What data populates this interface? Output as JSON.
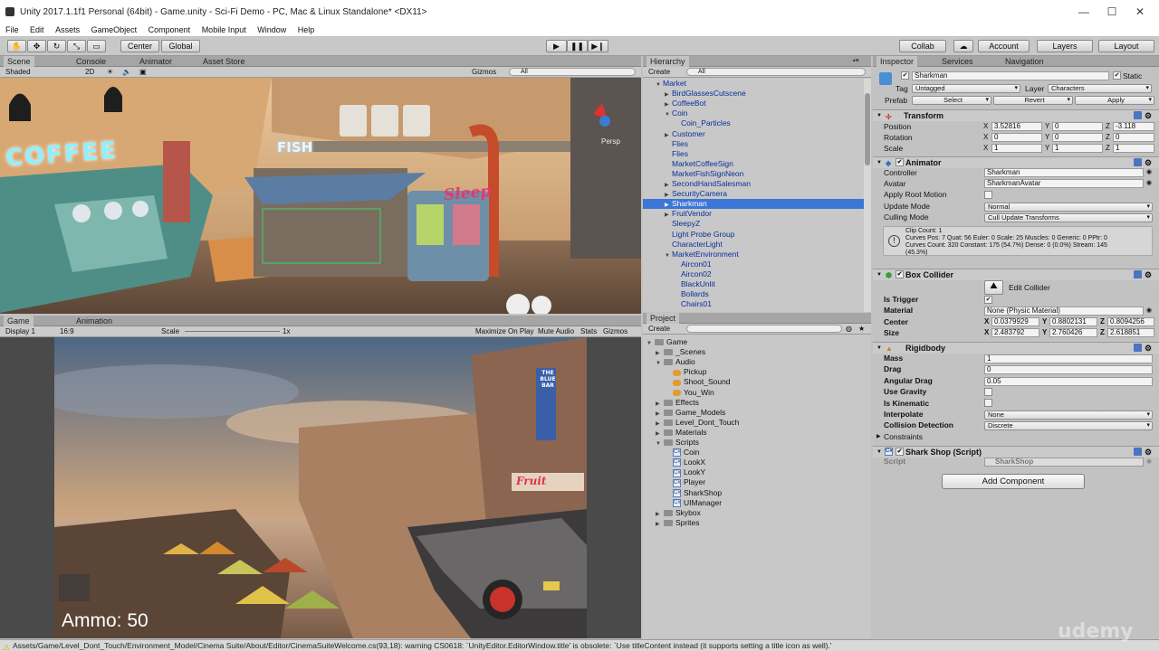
{
  "window": {
    "title": "Unity 2017.1.1f1 Personal (64bit) - Game.unity - Sci-Fi Demo - PC, Mac & Linux Standalone* <DX11>",
    "minimize": "—",
    "maximize": "☐",
    "close": "✕"
  },
  "menu": [
    "File",
    "Edit",
    "Assets",
    "GameObject",
    "Component",
    "Mobile Input",
    "Window",
    "Help"
  ],
  "toolbar": {
    "pivot": "Center",
    "space": "Global",
    "collab": "Collab",
    "account": "Account",
    "layers": "Layers",
    "layout": "Layout"
  },
  "scene": {
    "tabs": [
      "Scene",
      "Console",
      "Animator",
      "Asset Store"
    ],
    "shading": "Shaded",
    "mode2d": "2D",
    "gizmos": "Gizmos",
    "search": "All",
    "persp": "Persp",
    "sign_coffee": "COFFEE",
    "sign_fish": "FISH",
    "sign_sleep": "Sleep"
  },
  "game": {
    "tabs": [
      "Game",
      "Animation"
    ],
    "display": "Display 1",
    "aspect": "16:9",
    "scale_label": "Scale",
    "scale_value": "1x",
    "maximize": "Maximize On Play",
    "mute": "Mute Audio",
    "stats": "Stats",
    "gizmos": "Gizmos",
    "ammo": "Ammo: 50",
    "sign_bar": "THE BLUE BAR",
    "sign_fruit": "Fruit"
  },
  "hierarchy": {
    "tab": "Hierarchy",
    "create": "Create",
    "search": "All",
    "items": [
      {
        "label": "Market",
        "depth": 0,
        "arrow": "▼"
      },
      {
        "label": "BirdGlassesCutscene",
        "depth": 1,
        "arrow": "▶"
      },
      {
        "label": "CoffeeBot",
        "depth": 1,
        "arrow": "▶"
      },
      {
        "label": "Coin",
        "depth": 1,
        "arrow": "▼"
      },
      {
        "label": "Coin_Particles",
        "depth": 2,
        "arrow": ""
      },
      {
        "label": "Customer",
        "depth": 1,
        "arrow": "▶"
      },
      {
        "label": "Flies",
        "depth": 1,
        "arrow": ""
      },
      {
        "label": "Flies",
        "depth": 1,
        "arrow": ""
      },
      {
        "label": "MarketCoffeeSign",
        "depth": 1,
        "arrow": ""
      },
      {
        "label": "MarketFishSignNeon",
        "depth": 1,
        "arrow": ""
      },
      {
        "label": "SecondHandSalesman",
        "depth": 1,
        "arrow": "▶"
      },
      {
        "label": "SecurityCamera",
        "depth": 1,
        "arrow": "▶"
      },
      {
        "label": "Sharkman",
        "depth": 1,
        "arrow": "▶",
        "selected": true
      },
      {
        "label": "FruitVendor",
        "depth": 1,
        "arrow": "▶"
      },
      {
        "label": "SleepyZ",
        "depth": 1,
        "arrow": ""
      },
      {
        "label": "Light Probe Group",
        "depth": 1,
        "arrow": ""
      },
      {
        "label": "CharacterLight",
        "depth": 1,
        "arrow": ""
      },
      {
        "label": "MarketEnvironment",
        "depth": 1,
        "arrow": "▼"
      },
      {
        "label": "Aircon01",
        "depth": 2,
        "arrow": ""
      },
      {
        "label": "Aircon02",
        "depth": 2,
        "arrow": ""
      },
      {
        "label": "BlackUnlit",
        "depth": 2,
        "arrow": ""
      },
      {
        "label": "Bollards",
        "depth": 2,
        "arrow": ""
      },
      {
        "label": "Chairs01",
        "depth": 2,
        "arrow": ""
      }
    ]
  },
  "project": {
    "tab": "Project",
    "create": "Create",
    "items": [
      {
        "label": "Game",
        "depth": 0,
        "kind": "folder",
        "arrow": "▼"
      },
      {
        "label": "_Scenes",
        "depth": 1,
        "kind": "folder",
        "arrow": "▶"
      },
      {
        "label": "Audio",
        "depth": 1,
        "kind": "folder",
        "arrow": "▼"
      },
      {
        "label": "Pickup",
        "depth": 2,
        "kind": "audio",
        "arrow": ""
      },
      {
        "label": "Shoot_Sound",
        "depth": 2,
        "kind": "audio",
        "arrow": ""
      },
      {
        "label": "You_Win",
        "depth": 2,
        "kind": "audio",
        "arrow": ""
      },
      {
        "label": "Effects",
        "depth": 1,
        "kind": "folder",
        "arrow": "▶"
      },
      {
        "label": "Game_Models",
        "depth": 1,
        "kind": "folder",
        "arrow": "▶"
      },
      {
        "label": "Level_Dont_Touch",
        "depth": 1,
        "kind": "folder",
        "arrow": "▶"
      },
      {
        "label": "Materials",
        "depth": 1,
        "kind": "folder",
        "arrow": "▶"
      },
      {
        "label": "Scripts",
        "depth": 1,
        "kind": "folder",
        "arrow": "▼"
      },
      {
        "label": "Coin",
        "depth": 2,
        "kind": "script",
        "arrow": ""
      },
      {
        "label": "LookX",
        "depth": 2,
        "kind": "script",
        "arrow": ""
      },
      {
        "label": "LookY",
        "depth": 2,
        "kind": "script",
        "arrow": ""
      },
      {
        "label": "Player",
        "depth": 2,
        "kind": "script",
        "arrow": ""
      },
      {
        "label": "SharkShop",
        "depth": 2,
        "kind": "script",
        "arrow": ""
      },
      {
        "label": "UIManager",
        "depth": 2,
        "kind": "script",
        "arrow": ""
      },
      {
        "label": "Skybox",
        "depth": 1,
        "kind": "folder",
        "arrow": "▶"
      },
      {
        "label": "Sprites",
        "depth": 1,
        "kind": "folder",
        "arrow": "▶"
      }
    ]
  },
  "inspector": {
    "tabs": [
      "Inspector",
      "Services",
      "Navigation"
    ],
    "object_name": "Sharkman",
    "static_label": "Static",
    "tag_label": "Tag",
    "tag_value": "Untagged",
    "layer_label": "Layer",
    "layer_value": "Characters",
    "prefab_label": "Prefab",
    "prefab_select": "Select",
    "prefab_revert": "Revert",
    "prefab_apply": "Apply",
    "transform": {
      "title": "Transform",
      "position_label": "Position",
      "position": [
        "3.52816",
        "0",
        "-3.118"
      ],
      "rotation_label": "Rotation",
      "rotation": [
        "0",
        "0",
        "0"
      ],
      "scale_label": "Scale",
      "scale": [
        "1",
        "1",
        "1"
      ]
    },
    "animator": {
      "title": "Animator",
      "controller_label": "Controller",
      "controller": "Sharkman",
      "avatar_label": "Avatar",
      "avatar": "SharkmanAvatar",
      "root_motion_label": "Apply Root Motion",
      "update_mode_label": "Update Mode",
      "update_mode": "Normal",
      "culling_label": "Culling Mode",
      "culling": "Cull Update Transforms",
      "info_lines": [
        "Clip Count: 1",
        "Curves Pos: 7 Quat: 56 Euler: 0 Scale: 25 Muscles: 0 Generic: 0 PPtr: 0",
        "Curves Count: 320 Constant: 175 (54.7%) Dense: 0 (0.0%) Stream: 145",
        "(45.3%)"
      ]
    },
    "box_collider": {
      "title": "Box Collider",
      "edit_label": "Edit Collider",
      "trigger_label": "Is Trigger",
      "material_label": "Material",
      "material": "None (Physic Material)",
      "center_label": "Center",
      "center": [
        "0.0379929",
        "0.8802131",
        "0.8094256"
      ],
      "size_label": "Size",
      "size": [
        "2.483792",
        "2.760426",
        "2.618851"
      ]
    },
    "rigidbody": {
      "title": "Rigidbody",
      "mass_label": "Mass",
      "mass": "1",
      "drag_label": "Drag",
      "drag": "0",
      "angular_label": "Angular Drag",
      "angular": "0.05",
      "gravity_label": "Use Gravity",
      "kinematic_label": "Is Kinematic",
      "interpolate_label": "Interpolate",
      "interpolate": "None",
      "collision_label": "Collision Detection",
      "collision": "Discrete",
      "constraints_label": "Constraints"
    },
    "shark_shop": {
      "title": "Shark Shop (Script)",
      "script_label": "Script",
      "script": "SharkShop"
    },
    "add_component": "Add Component"
  },
  "status": "Assets/Game/Level_Dont_Touch/Environment_Model/Cinema Suite/About/Editor/CinemaSuiteWelcome.cs(93,18): warning CS0618: `UnityEditor.EditorWindow.title' is obsolete: `Use titleContent instead (it supports setting a title icon as well).'",
  "watermark": "udemy"
}
